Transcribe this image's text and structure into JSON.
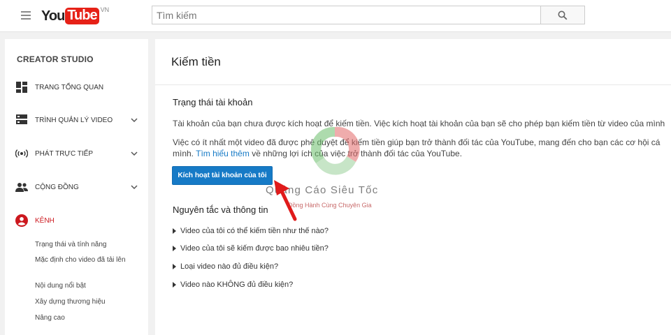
{
  "masthead": {
    "logo_you": "You",
    "logo_tube": "Tube",
    "logo_country": "VN",
    "search_placeholder": "Tìm kiếm"
  },
  "sidebar": {
    "title": "CREATOR STUDIO",
    "items": [
      {
        "label": "TRANG TỔNG QUAN",
        "icon": "dashboard-icon",
        "expandable": false
      },
      {
        "label": "TRÌNH QUẢN LÝ VIDEO",
        "icon": "video-manager-icon",
        "expandable": true
      },
      {
        "label": "PHÁT TRỰC TIẾP",
        "icon": "live-broadcast-icon",
        "expandable": true
      },
      {
        "label": "CỘNG ĐỒNG",
        "icon": "community-icon",
        "expandable": true
      },
      {
        "label": "KÊNH",
        "icon": "channel-icon",
        "expandable": false,
        "active": true
      }
    ],
    "channel_subitems": [
      "Trạng thái và tính năng",
      "Mặc định cho video đã tải lên",
      "Nội dung nổi bật",
      "Xây dựng thương hiệu",
      "Nâng cao"
    ],
    "active_color": "#cc181e"
  },
  "main": {
    "title": "Kiếm tiền",
    "status_heading": "Trạng thái tài khoản",
    "para1": "Tài khoản của bạn chưa được kích hoạt để kiếm tiền. Việc kích hoạt tài khoản của bạn sẽ cho phép bạn kiếm tiền từ video của mình",
    "para2_a": "Việc có ít nhất một video đã được phê duyệt để kiếm tiền giúp bạn trở thành đối tác của YouTube, mang đến cho bạn các cơ hội cá",
    "para2_b": "mình.",
    "para2_link": "Tìm hiểu thêm",
    "para2_c": "về những lợi ích của việc trở thành đối tác của YouTube.",
    "activate_button": "Kích hoạt tài khoản của tôi",
    "rules_heading": "Nguyên tắc và thông tin",
    "faq": [
      "Video của tôi có thể kiếm tiền như thế nào?",
      "Video của tôi sẽ kiếm được bao nhiêu tiền?",
      "Loại video nào đủ điều kiện?",
      "Video nào KHÔNG đủ điều kiện?"
    ],
    "link_color": "#167ac6",
    "button_color": "#167ac6"
  },
  "watermark": {
    "name": "Quảng Cáo Siêu Tốc",
    "tagline": "Đồng Hành Cùng Chuyên Gia"
  }
}
